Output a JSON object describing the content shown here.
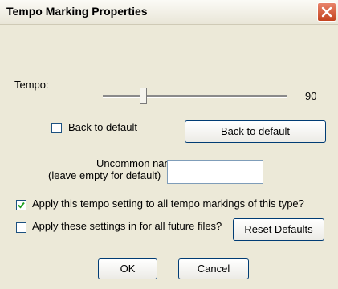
{
  "window": {
    "title": "Tempo Marking Properties"
  },
  "tempo": {
    "label": "Tempo:",
    "value": "90",
    "slider_fraction": 0.21
  },
  "back_default_checkbox": {
    "label": "Back to default",
    "checked": false
  },
  "back_default_button": {
    "label": "Back to default"
  },
  "uncommon_name": {
    "label_line1": "Uncommon name:",
    "label_line2": "(leave empty for default)",
    "value": ""
  },
  "apply_all_checkbox": {
    "label": "Apply this tempo setting to all tempo markings of this type?",
    "checked": true
  },
  "future_files_checkbox": {
    "label": "Apply these settings in for all future files?",
    "checked": false
  },
  "reset_button": {
    "label": "Reset Defaults"
  },
  "ok_button": {
    "label": "OK"
  },
  "cancel_button": {
    "label": "Cancel"
  },
  "colors": {
    "dialog_bg": "#ece9d8",
    "close_red": "#c4441f",
    "button_border": "#003c74"
  }
}
